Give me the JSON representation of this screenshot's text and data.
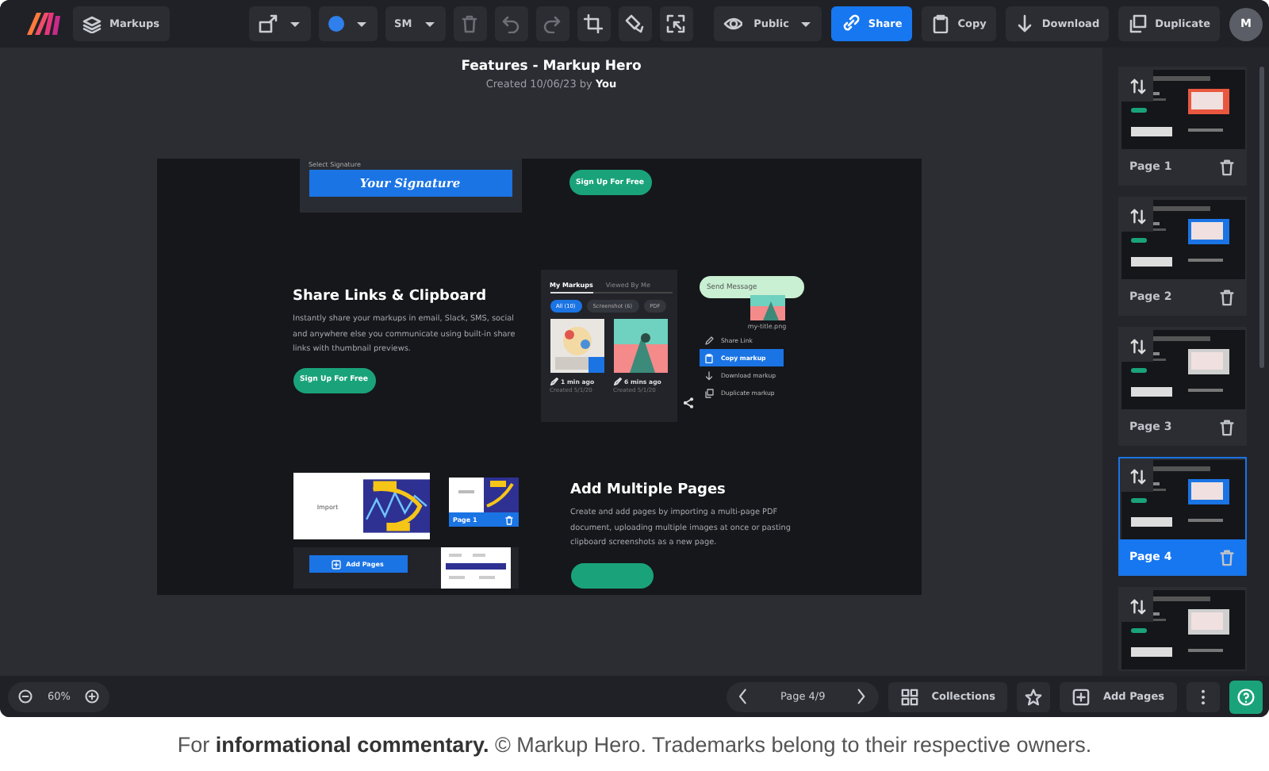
{
  "toolbar": {
    "markups": "Markups",
    "size": "SM",
    "visibility": "Public",
    "share": "Share",
    "copy": "Copy",
    "download": "Download",
    "duplicate": "Duplicate",
    "avatar": "M"
  },
  "document": {
    "title": "Features - Markup Hero",
    "created": "Created 10/06/23 by **You**"
  },
  "canvas": {
    "signature_label": "Select Signature",
    "signature": "Your Signature",
    "signup_top": "Sign Up For Free",
    "share_heading": "Share Links & Clipboard",
    "share_text": "Instantly share your markups in email, Slack, SMS, social and anywhere else you communicate using built-in share links with thumbnail previews.",
    "share_signup": "Sign Up For Free",
    "tabs": [
      {
        "label": "My Markups",
        "selected": true
      },
      {
        "label": "Viewed By Me",
        "selected": false
      }
    ],
    "filters": [
      {
        "label": "All (10)",
        "selected": true
      },
      {
        "label": "Screenshot (6)",
        "selected": false
      },
      {
        "label": "PDF",
        "selected": false
      }
    ],
    "markups": [
      {
        "age": "1 min ago",
        "created": "Created 5/1/20"
      },
      {
        "age": "6 mins ago",
        "created": "Created 5/1/20"
      }
    ],
    "message": "Send Message",
    "file": "my-title.png",
    "menu": [
      {
        "label": "Share Link",
        "selected": false
      },
      {
        "label": "Copy markup",
        "selected": true
      },
      {
        "label": "Download markup",
        "selected": false
      },
      {
        "label": "Duplicate markup",
        "selected": false
      }
    ],
    "import_label": "Import",
    "page_label": "Page 1",
    "add_pages": "Add Pages",
    "pages_heading": "Add Multiple Pages",
    "pages_text": "Create and add pages by importing a multi-page PDF document, uploading multiple images at once or pasting clipboard screenshots as a new page."
  },
  "pages": [
    {
      "label": "Page 1",
      "selected": false
    },
    {
      "label": "Page 2",
      "selected": false
    },
    {
      "label": "Page 3",
      "selected": false
    },
    {
      "label": "Page 4",
      "selected": true
    },
    {
      "selected": false
    }
  ],
  "bottom_bar": {
    "zoom": "60%",
    "page": "Page 4/9",
    "collections": "Collections",
    "add_pages": "Add Pages"
  },
  "caption": "For **informational commentary.** © Markup Hero. Trademarks belong to their respective owners."
}
